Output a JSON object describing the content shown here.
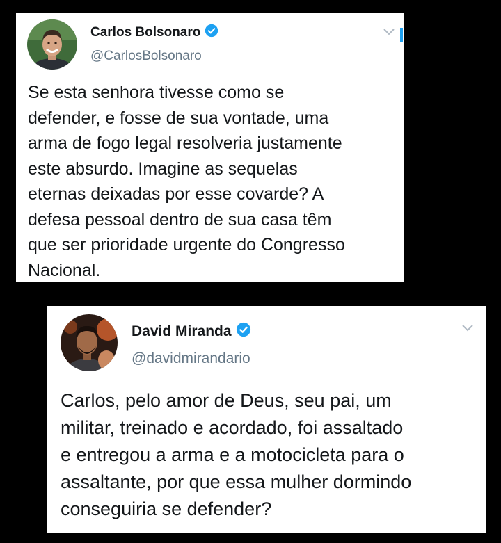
{
  "tweets": [
    {
      "display_name": "Carlos Bolsonaro",
      "handle": "@CarlosBolsonaro",
      "verified": true,
      "avatar_icon": "profile-photo-carlos",
      "text": "Se esta senhora tivesse como se\ndefender, e fosse de sua vontade, uma\narma de fogo legal resolveria justamente\neste absurdo. Imagine as sequelas\neternas deixadas por esse covarde? A\ndefesa pessoal dentro de sua casa têm\nque ser prioridade urgente do Congresso\nNacional."
    },
    {
      "display_name": "David Miranda",
      "handle": "@davidmirandario",
      "verified": true,
      "avatar_icon": "profile-photo-david",
      "text": "Carlos, pelo amor de Deus, seu pai, um\nmilitar, treinado e acordado, foi assaltado\ne entregou a arma e a motocicleta para o\nassaltante, por que essa mulher dormindo\nconseguiria se defender?"
    }
  ],
  "colors": {
    "background": "#000000",
    "card": "#ffffff",
    "text": "#14171a",
    "handle": "#657786",
    "verified": "#1da1f2",
    "chevron": "#b0bac4"
  }
}
